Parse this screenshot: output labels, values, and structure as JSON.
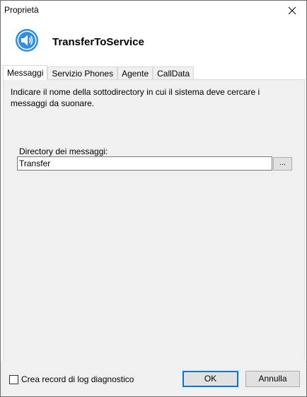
{
  "window": {
    "title": "Proprietà"
  },
  "header": {
    "title": "TransferToService",
    "icon": "speaker-icon"
  },
  "tabs": [
    {
      "label": "Messaggi",
      "active": true
    },
    {
      "label": "Servizio Phones",
      "active": false
    },
    {
      "label": "Agente",
      "active": false
    },
    {
      "label": "CallData",
      "active": false
    }
  ],
  "panel": {
    "description": "Indicare il nome della sottodirectory in cui il sistema deve cercare i messaggi da suonare.",
    "directory_label": "Directory dei messaggi:",
    "directory_value": "Transfer",
    "browse_label": "..."
  },
  "footer": {
    "checkbox_label": "Crea record di log diagnostico",
    "checkbox_checked": false,
    "ok_label": "OK",
    "cancel_label": "Annulla"
  },
  "colors": {
    "accent": "#0078d7",
    "icon_blue": "#1e88e5"
  }
}
